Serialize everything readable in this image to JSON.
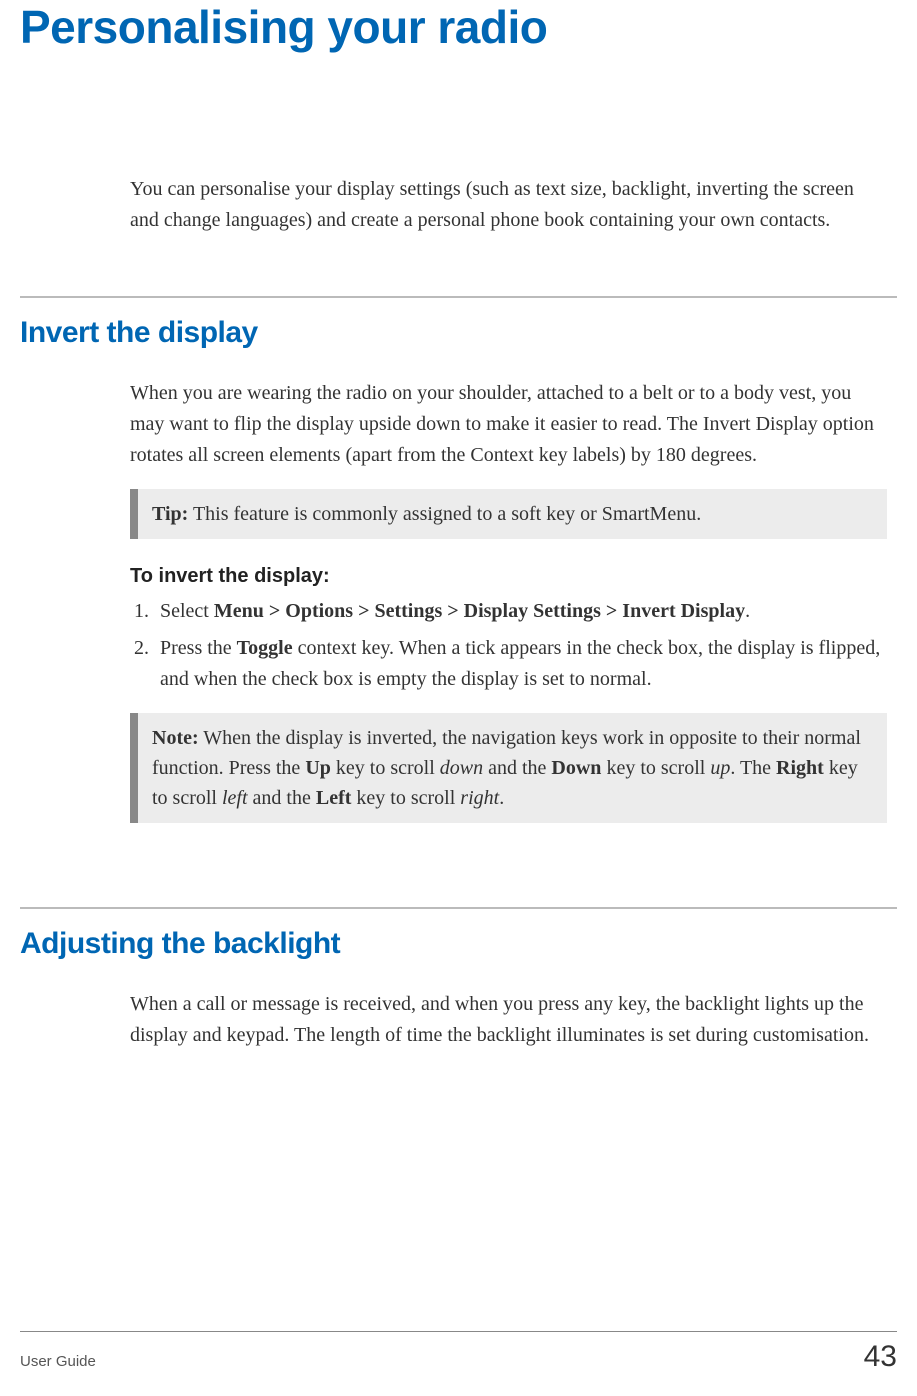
{
  "title": "Personalising your radio",
  "intro": "You can personalise your display settings (such as text size, backlight, inverting the screen and change languages) and create a personal phone book containing your own contacts.",
  "sections": [
    {
      "heading": "Invert the display",
      "para": "When you are wearing the radio on your shoulder, attached to a belt or to a body vest, you may want to flip the display upside down to make it easier to read. The Invert Display option rotates all screen elements (apart from the Context key labels)  by 180 degrees.",
      "tip_label": "Tip:",
      "tip_text": "  This feature is commonly assigned to a soft key or SmartMenu.",
      "subheading": "To invert the display:",
      "steps": [
        {
          "pre": "Select ",
          "bold": "Menu > Options > Settings > Display Settings > Invert Display",
          "post": "."
        },
        {
          "pre": "Press the ",
          "bold": "Toggle",
          "post": " context key. When a tick appears in the check box, the display is flipped, and when the check box is empty the display is set to normal."
        }
      ],
      "note_label": "Note:",
      "note": {
        "t1": "  When the display is inverted, the navigation keys work in opposite to their normal function. Press the ",
        "b1": "Up",
        "t2": " key to scroll ",
        "i1": "down",
        "t3": " and the ",
        "b2": "Down",
        "t4": " key to scroll ",
        "i2": "up",
        "t5": ". The ",
        "b3": "Right",
        "t6": " key to scroll ",
        "i3": "left",
        "t7": " and the ",
        "b4": "Left",
        "t8": " key to scroll ",
        "i4": "right",
        "t9": "."
      }
    },
    {
      "heading": "Adjusting the backlight",
      "para": "When a call or message is received, and when you press any key, the backlight lights up the display and keypad. The length of time the backlight illuminates is set during customisation."
    }
  ],
  "footer": {
    "left": "User Guide",
    "right": "43"
  }
}
